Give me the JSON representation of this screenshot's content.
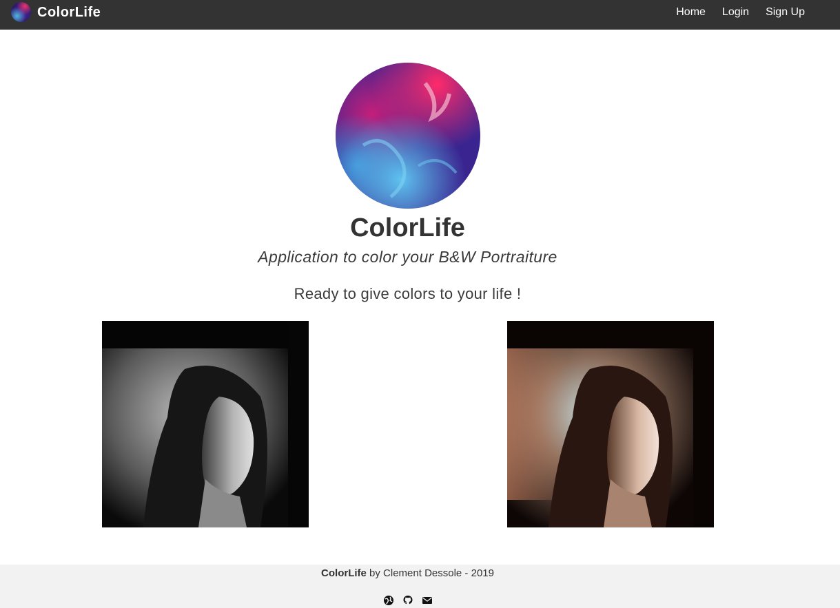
{
  "navbar": {
    "brand_name": "ColorLife",
    "links": [
      {
        "label": "Home"
      },
      {
        "label": "Login"
      },
      {
        "label": "Sign Up"
      }
    ]
  },
  "hero": {
    "title": "ColorLife",
    "subtitle": "Application to color your B&W Portraiture",
    "tagline": "Ready to give colors to your life !"
  },
  "photos": {
    "before_icon": "bw-portrait-image",
    "after_icon": "colorized-portrait-image"
  },
  "footer": {
    "brand": "ColorLife",
    "credit": " by Clement Dessole - 2019",
    "icons": [
      "globe-icon",
      "github-icon",
      "envelope-icon"
    ]
  },
  "colors": {
    "navbar_bg": "#333333",
    "footer_bg": "#f2f2f2",
    "text": "#333333"
  }
}
